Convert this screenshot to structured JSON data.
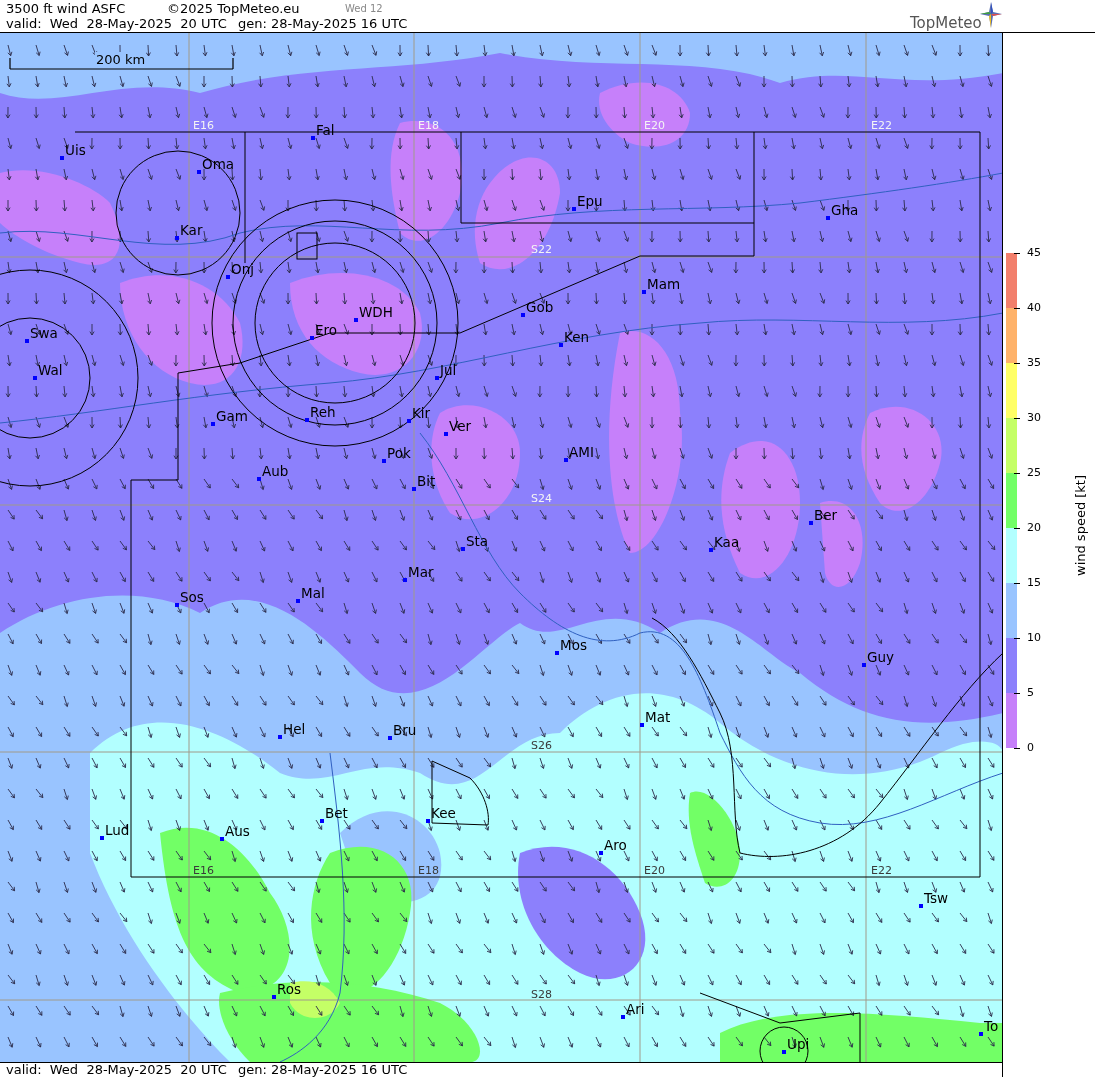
{
  "header": {
    "title": "3500 ft wind ASFC",
    "copyright": "©2025 TopMeteo.eu",
    "run": "Wed 12",
    "valid": "valid:  Wed  28-May-2025  20 UTC",
    "gen": "gen: 28-May-2025 16 UTC",
    "logo": "TopMeteo"
  },
  "map": {
    "scale": "200 km",
    "grid_labels": [
      "E16",
      "E18",
      "E20",
      "E22",
      "S22",
      "S24",
      "S26",
      "S28",
      "E16",
      "E18",
      "E20",
      "E22"
    ],
    "places": [
      "Uis",
      "Oma",
      "Fal",
      "Kar",
      "Epu",
      "Gha",
      "Onj",
      "Mam",
      "Swa",
      "WDH",
      "Gob",
      "Ero",
      "Ken",
      "Wal",
      "Jul",
      "Gam",
      "Reh",
      "Kir",
      "Ver",
      "Pok",
      "AMI",
      "Bit",
      "Aub",
      "Ber",
      "Sta",
      "Kaa",
      "Mar",
      "Sos",
      "Mal",
      "Mos",
      "Guy",
      "Mat",
      "Hel",
      "Bru",
      "Bet",
      "Kee",
      "Lud",
      "Aus",
      "Aro",
      "Tsw",
      "Ros",
      "Ari",
      "Upi",
      "To"
    ]
  },
  "legend": {
    "title": "wind speed [kt]",
    "ticks": [
      "45",
      "40",
      "35",
      "30",
      "25",
      "20",
      "15",
      "10",
      "5",
      "0"
    ],
    "bands": [
      {
        "color": "#f27f6c"
      },
      {
        "color": "#feb26a"
      },
      {
        "color": "#ffff66"
      },
      {
        "color": "#c4ff66"
      },
      {
        "color": "#72ff66"
      },
      {
        "color": "#b2ffff"
      },
      {
        "color": "#99c4ff"
      },
      {
        "color": "#8c80fc"
      },
      {
        "color": "#c680fa"
      }
    ]
  },
  "footer": {
    "valid": "valid:  Wed  28-May-2025  20 UTC",
    "gen": "gen: 28-May-2025 16 UTC"
  }
}
